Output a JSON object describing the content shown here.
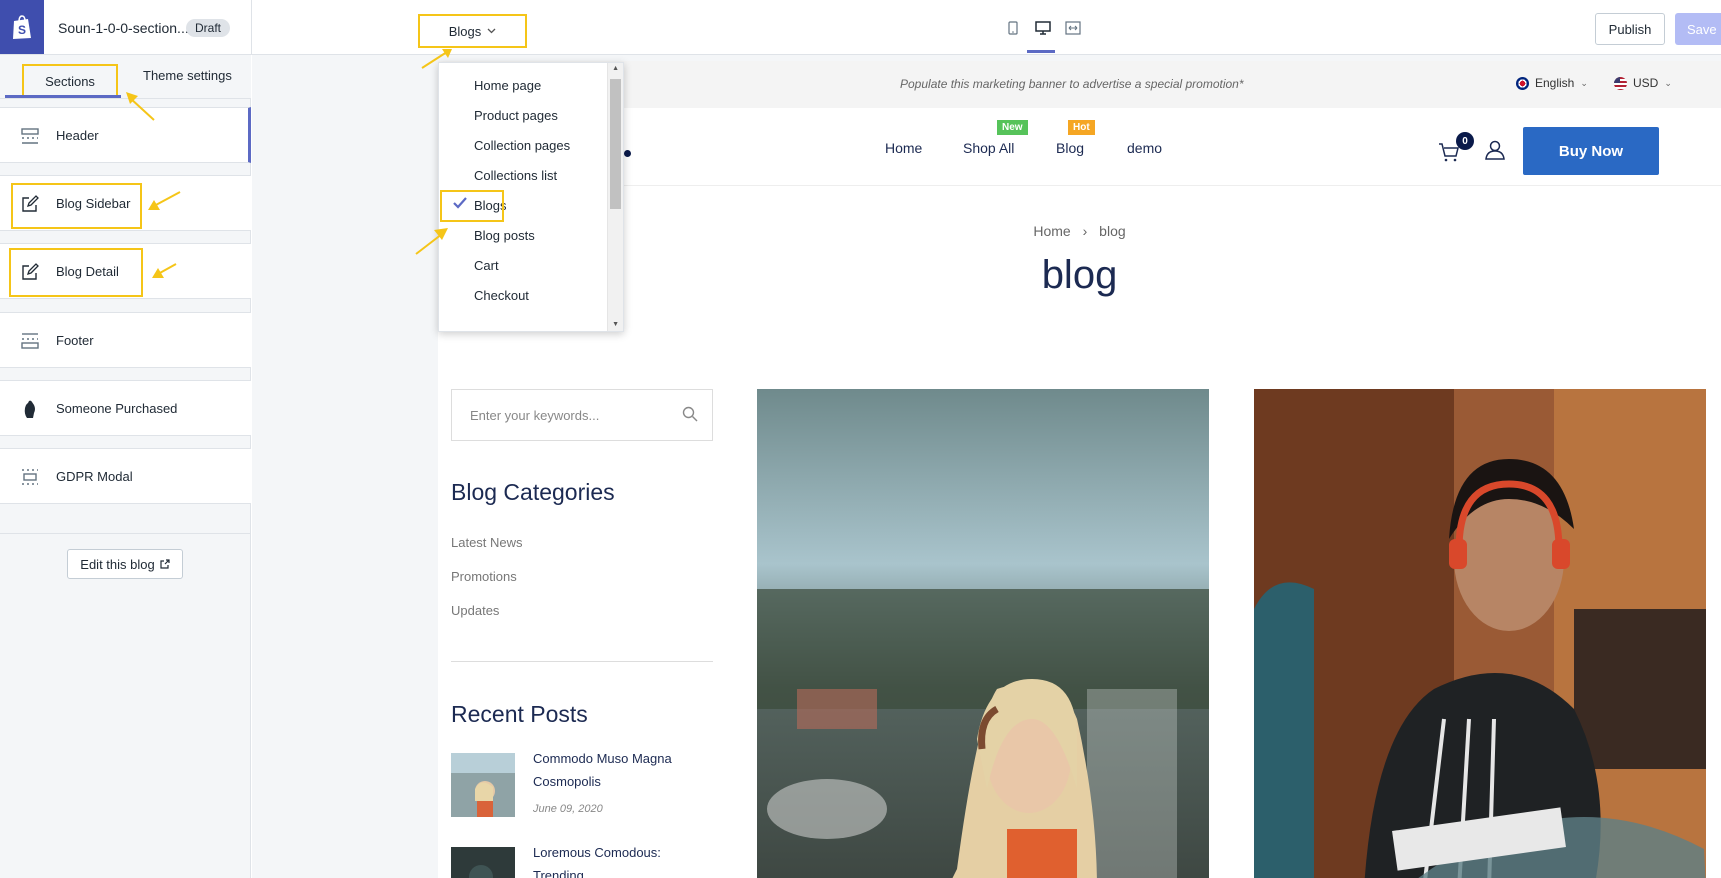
{
  "topbar": {
    "theme_name": "Soun-1-0-0-section...",
    "draft": "Draft",
    "template": "Blogs",
    "publish": "Publish",
    "save": "Save"
  },
  "sidebar": {
    "tabs": {
      "sections": "Sections",
      "theme_settings": "Theme settings"
    },
    "items": [
      {
        "label": "Header",
        "icon": "header-section-icon"
      },
      {
        "label": "Blog Sidebar",
        "icon": "edit-section-icon"
      },
      {
        "label": "Blog Detail",
        "icon": "edit-section-icon"
      },
      {
        "label": "Footer",
        "icon": "footer-section-icon"
      },
      {
        "label": "Someone Purchased",
        "icon": "hand-icon"
      },
      {
        "label": "GDPR Modal",
        "icon": "modal-section-icon"
      }
    ],
    "edit_blog": "Edit this blog"
  },
  "dropdown": {
    "items": [
      "Home page",
      "Product pages",
      "Collection pages",
      "Collections list",
      "Blogs",
      "Blog posts",
      "Cart",
      "Checkout"
    ],
    "selected": "Blogs"
  },
  "store": {
    "announcement": "Populate this marketing banner to advertise a special promotion*",
    "language": "English",
    "currency": "USD",
    "nav": [
      {
        "label": "Home",
        "badge": ""
      },
      {
        "label": "Shop All",
        "badge": "New"
      },
      {
        "label": "Blog",
        "badge": "Hot"
      },
      {
        "label": "demo",
        "badge": ""
      }
    ],
    "cart_count": "0",
    "buy_now": "Buy Now",
    "breadcrumb": {
      "home": "Home",
      "separator": "›",
      "current": "blog"
    },
    "page_title": "blog",
    "search_placeholder": "Enter your keywords...",
    "categories_title": "Blog Categories",
    "categories": [
      "Latest News",
      "Promotions",
      "Updates"
    ],
    "recent_title": "Recent Posts",
    "recent_posts": [
      {
        "title": "Commodo Muso Magna Cosmopolis",
        "date": "June 09, 2020"
      },
      {
        "title": "Loremous Comodous: Trending",
        "date": ""
      }
    ]
  },
  "colors": {
    "accent": "#5c6ac4",
    "highlight": "#f5c518",
    "brand_blue": "#2a69c4",
    "navy": "#1c2a52"
  }
}
